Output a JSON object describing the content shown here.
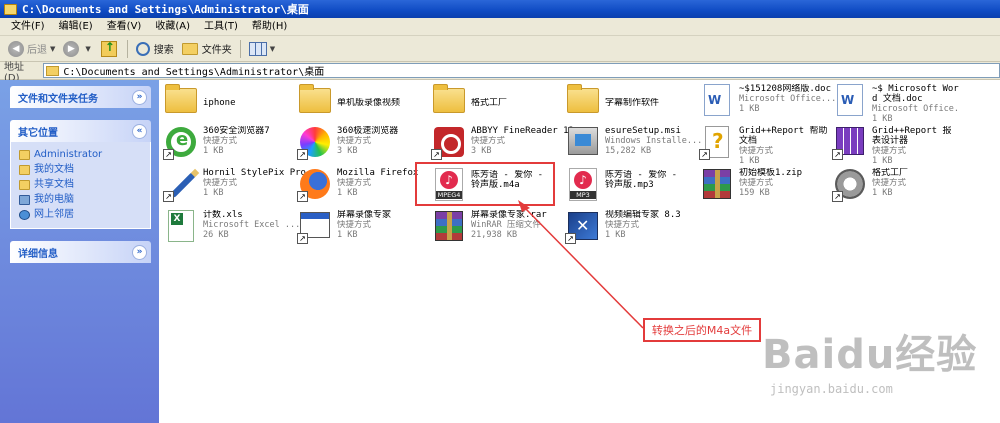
{
  "window": {
    "title": "C:\\Documents and Settings\\Administrator\\桌面"
  },
  "menu": [
    "文件(F)",
    "编辑(E)",
    "查看(V)",
    "收藏(A)",
    "工具(T)",
    "帮助(H)"
  ],
  "toolbar": {
    "back": "后退",
    "search": "搜索",
    "folders": "文件夹"
  },
  "address": {
    "label": "地址(D)",
    "value": "C:\\Documents and Settings\\Administrator\\桌面"
  },
  "sidebar": {
    "tasks_title": "文件和文件夹任务",
    "places_title": "其它位置",
    "places": [
      "Administrator",
      "我的文档",
      "共享文档",
      "我的电脑",
      "网上邻居"
    ],
    "details_title": "详细信息"
  },
  "files": [
    {
      "name": "iphone"
    },
    {
      "name": "单机版录像视频"
    },
    {
      "name": "格式工厂"
    },
    {
      "name": "字幕制作软件"
    },
    {
      "name": "~$151208网络版.doc",
      "type": "Microsoft Office...",
      "size": "1 KB"
    },
    {
      "name": "~$ Microsoft Word 文档.doc",
      "type": "Microsoft Office...",
      "size": "1 KB"
    },
    {
      "name": "360安全浏览器7",
      "type": "快捷方式",
      "size": "1 KB"
    },
    {
      "name": "360极速浏览器",
      "type": "快捷方式",
      "size": "3 KB"
    },
    {
      "name": "ABBYY FineReader 12",
      "type": "快捷方式",
      "size": "3 KB"
    },
    {
      "name": "esureSetup.msi",
      "type": "Windows Installe...",
      "size": "15,282 KB"
    },
    {
      "name": "Grid++Report 帮助文档",
      "type": "快捷方式",
      "size": "1 KB"
    },
    {
      "name": "Grid++Report 报表设计器",
      "type": "快捷方式",
      "size": "1 KB"
    },
    {
      "name": "Hornil StylePix Pro",
      "type": "快捷方式",
      "size": "1 KB"
    },
    {
      "name": "Mozilla Firefox",
      "type": "快捷方式",
      "size": "1 KB"
    },
    {
      "name": "陈芳语 - 爱你 - 铃声版.m4a",
      "tag": "MPEG4"
    },
    {
      "name": "陈芳语 - 爱你 - 铃声版.mp3",
      "tag": "MP3"
    },
    {
      "name": "初始模板1.zip",
      "type": "快捷方式",
      "size": "159 KB"
    },
    {
      "name": "格式工厂",
      "type": "快捷方式",
      "size": "1 KB"
    },
    {
      "name": "计数.xls",
      "type": "Microsoft Excel ...",
      "size": "26 KB"
    },
    {
      "name": "屏幕录像专家",
      "type": "快捷方式",
      "size": "1 KB"
    },
    {
      "name": "屏幕录像专家.rar",
      "type": "WinRAR 压缩文件",
      "size": "21,938 KB"
    },
    {
      "name": "视频编辑专家 8.3",
      "type": "快捷方式",
      "size": "1 KB"
    }
  ],
  "annotation": {
    "text": "转换之后的M4a文件",
    "color": "#e33b3b"
  },
  "watermark": {
    "main": "Baidu经验",
    "sub": "jingyan.baidu.com"
  }
}
